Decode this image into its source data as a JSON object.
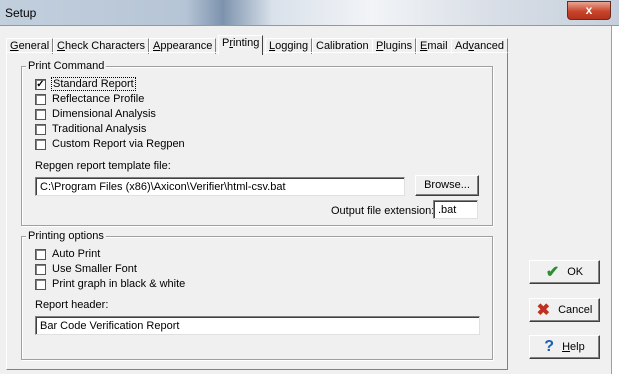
{
  "window": {
    "title": "Setup",
    "close_glyph": "x"
  },
  "tabs": [
    {
      "pre": "",
      "u": "G",
      "post": "eneral"
    },
    {
      "pre": "",
      "u": "C",
      "post": "heck Characters"
    },
    {
      "pre": "",
      "u": "A",
      "post": "ppearance"
    },
    {
      "pre": "P",
      "u": "r",
      "post": "inting"
    },
    {
      "pre": "",
      "u": "L",
      "post": "ogging"
    },
    {
      "pre": "Calibration",
      "u": "",
      "post": ""
    },
    {
      "pre": "",
      "u": "P",
      "post": "lugins"
    },
    {
      "pre": "",
      "u": "E",
      "post": "mail"
    },
    {
      "pre": "Ad",
      "u": "v",
      "post": "anced"
    }
  ],
  "print_command": {
    "label": "Print Command",
    "options": [
      {
        "label": "Standard Report",
        "checked": true
      },
      {
        "label": "Reflectance Profile",
        "checked": false
      },
      {
        "label": "Dimensional Analysis",
        "checked": false
      },
      {
        "label": "Traditional Analysis",
        "checked": false
      },
      {
        "label": "Custom Report via Regpen",
        "checked": false
      }
    ],
    "template_label": "Repgen report template file:",
    "template_value": "C:\\Program Files (x86)\\Axicon\\Verifier\\html-csv.bat",
    "browse_label": "Browse...",
    "extension_label": "Output file extension:",
    "extension_value": ".bat"
  },
  "printing_options": {
    "label": "Printing options",
    "options": [
      {
        "label": "Auto Print",
        "checked": false
      },
      {
        "label": "Use Smaller Font",
        "checked": false
      },
      {
        "label": "Print graph in black & white",
        "checked": false
      }
    ],
    "header_label": "Report header:",
    "header_value": "Bar Code Verification Report"
  },
  "buttons": {
    "ok": "OK",
    "cancel": "Cancel",
    "help_pre": "",
    "help_u": "H",
    "help_post": "elp"
  },
  "icons": {
    "ok": "checkmark-icon",
    "cancel": "x-icon",
    "help": "question-icon"
  }
}
